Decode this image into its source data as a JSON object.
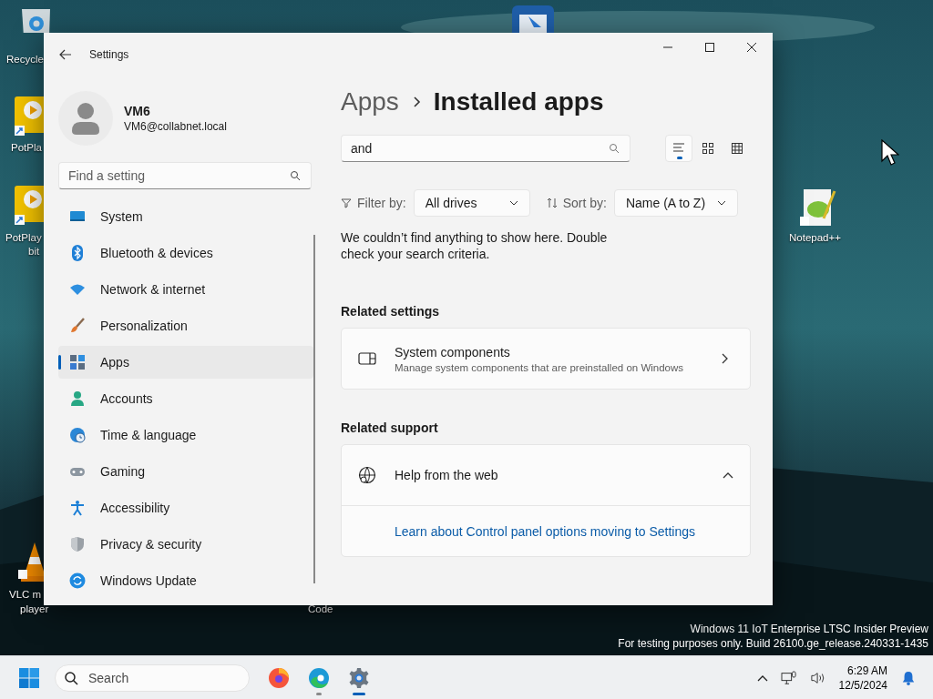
{
  "desktop": {
    "icons": [
      {
        "kind": "recycle",
        "lines": [
          "Recycle"
        ]
      },
      {
        "kind": "potplayer",
        "lines": [
          "PotPla"
        ]
      },
      {
        "kind": "potplayer",
        "lines": [
          "PotPlay",
          "bit"
        ]
      },
      {
        "kind": "vlc",
        "lines": [
          "VLC m",
          "player"
        ]
      },
      {
        "kind": "remote"
      },
      {
        "kind": "none",
        "lines": [
          "Code"
        ]
      },
      {
        "kind": "notepad",
        "lines": [
          "Notepad++"
        ]
      }
    ],
    "os_notice": [
      "Windows 11 IoT Enterprise LTSC Insider Preview",
      "For testing purposes only. Build 26100.ge_release.240331-1435"
    ]
  },
  "window": {
    "title": "Settings",
    "profile": {
      "name": "VM6",
      "email": "VM6@collabnet.local"
    },
    "search": {
      "placeholder": "Find a setting"
    },
    "nav": {
      "items": [
        {
          "kind": "system",
          "label": "System",
          "selected": false
        },
        {
          "kind": "bluetooth",
          "label": "Bluetooth & devices",
          "selected": false
        },
        {
          "kind": "network",
          "label": "Network & internet",
          "selected": false
        },
        {
          "kind": "personalization",
          "label": "Personalization",
          "selected": false
        },
        {
          "kind": "apps",
          "label": "Apps",
          "selected": true
        },
        {
          "kind": "accounts",
          "label": "Accounts",
          "selected": false
        },
        {
          "kind": "time",
          "label": "Time & language",
          "selected": false
        },
        {
          "kind": "gaming",
          "label": "Gaming",
          "selected": false
        },
        {
          "kind": "accessibility",
          "label": "Accessibility",
          "selected": false
        },
        {
          "kind": "privacy",
          "label": "Privacy & security",
          "selected": false
        },
        {
          "kind": "update",
          "label": "Windows Update",
          "selected": false
        }
      ]
    },
    "breadcrumb": {
      "parent": "Apps",
      "current": "Installed apps"
    },
    "app_search": {
      "value": "and"
    },
    "view_modes": [
      {
        "kind": "list",
        "selected": true
      },
      {
        "kind": "tiles",
        "selected": false
      },
      {
        "kind": "grid",
        "selected": false
      }
    ],
    "filter": {
      "label": "Filter by:",
      "value": "All drives"
    },
    "sort": {
      "label": "Sort by:",
      "value": "Name (A to Z)"
    },
    "empty_message": "We couldn’t find anything to show here. Double check your search criteria.",
    "related_settings": {
      "heading": "Related settings",
      "cards": [
        {
          "title": "System components",
          "description": "Manage system components that are preinstalled on Windows"
        }
      ]
    },
    "related_support": {
      "heading": "Related support",
      "title": "Help from the web",
      "expanded": true,
      "links": [
        "Learn about Control panel options moving to Settings"
      ]
    }
  },
  "taskbar": {
    "search_placeholder": "Search",
    "apps": [
      {
        "kind": "firefox",
        "running": false,
        "active": false
      },
      {
        "kind": "edge",
        "running": true,
        "active": false
      },
      {
        "kind": "settings",
        "running": true,
        "active": true
      }
    ],
    "time": "6:29 AM",
    "date": "12/5/2024"
  }
}
